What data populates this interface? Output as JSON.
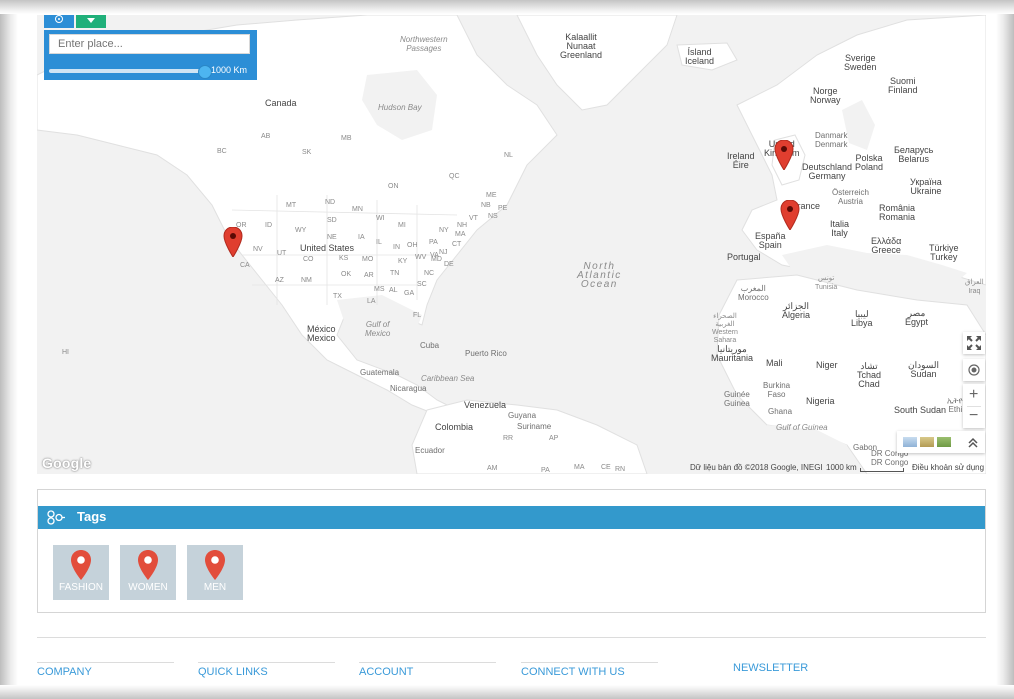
{
  "map": {
    "search": {
      "placeholder": "Enter place...",
      "radius_label": "1000 Km",
      "radius_fraction": 1.0
    },
    "labels": {
      "northwestern_passages": "Northwestern\nPassages",
      "kalaallit": "Kalaallit\nNunaat\nGreenland",
      "island": "Ísland\nIceland",
      "sverige": "Sverige\nSweden",
      "suomi": "Suomi\nFinland",
      "norge": "Norge\nNorway",
      "canada": "Canada",
      "hudson_bay": "Hudson Bay",
      "ab": "AB",
      "mb": "MB",
      "bc": "BC",
      "sk": "SK",
      "nl": "NL",
      "qc": "QC",
      "on": "ON",
      "pe": "PE",
      "nb": "NB",
      "ns": "NS",
      "mt": "MT",
      "nd": "ND",
      "mn": "MN",
      "sd": "SD",
      "wi": "WI",
      "mi": "MI",
      "or": "OR",
      "id": "ID",
      "wy": "WY",
      "ne": "NE",
      "ia": "IA",
      "il": "IL",
      "in": "IN",
      "oh": "OH",
      "pa": "PA",
      "ny": "NY",
      "vt": "VT",
      "nh": "NH",
      "me": "ME",
      "ma": "MA",
      "ct": "CT",
      "ri": "RI",
      "nj": "NJ",
      "md": "MD",
      "de": "DE",
      "nv": "NV",
      "ut": "UT",
      "co": "CO",
      "ks": "KS",
      "mo": "MO",
      "ky": "KY",
      "wv": "WV",
      "va": "VA",
      "ca": "CA",
      "az": "AZ",
      "nm": "NM",
      "ok": "OK",
      "ar": "AR",
      "tn": "TN",
      "nc": "NC",
      "sc": "SC",
      "ms": "MS",
      "al": "AL",
      "ga": "GA",
      "tx": "TX",
      "la": "LA",
      "fl": "FL",
      "hi": "HI",
      "united_states": "United States",
      "mexico": "México\nMexico",
      "gulf_of_mexico": "Gulf of\nMexico",
      "cuba": "Cuba",
      "puerto_rico": "Puerto Rico",
      "guatemala": "Guatemala",
      "nicaragua": "Nicaragua",
      "caribbean": "Caribbean Sea",
      "venezuela": "Venezuela",
      "guyana": "Guyana",
      "suriname": "Suriname",
      "colombia": "Colombia",
      "rr": "RR",
      "ap": "AP",
      "ecuador": "Ecuador",
      "am": "AM",
      "pa2": "PA",
      "ma2": "MA",
      "ce": "CE",
      "rn": "RN",
      "north_atlantic": "North\nAtlantic\nOcean",
      "ireland": "Ireland\nÉire",
      "united_kingdom": "United\nKingdom",
      "danmark": "Danmark\nDenmark",
      "deutschland": "Deutschland\nGermany",
      "polska": "Polska\nPoland",
      "belarus": "Беларусь\nBelarus",
      "ukraine": "Україна\nUkraine",
      "osterreich": "Österreich\nAustria",
      "france": "France",
      "romania": "România\nRomania",
      "italia": "Italia\nItaly",
      "espana": "España\nSpain",
      "portugal": "Portugal",
      "greece": "Ελλάδα\nGreece",
      "turkiye": "Türkiye\nTurkey",
      "tunisia": "تونس\nTunisia",
      "iraq": "العراق\nIraq",
      "morocco": "المغرب\nMorocco",
      "algeria": "الجزائر\nAlgeria",
      "libya": "ليبيا\nLibya",
      "egypt": "مصر\nEgypt",
      "western_sahara": "الصحراء\nالغربية\nWestern\nSahara",
      "mauritania": "موريتانيا\nMauritania",
      "mali": "Mali",
      "niger": "Niger",
      "chad": "تشاد\nTchad\nChad",
      "sudan": "السودان\nSudan",
      "burkina": "Burkina\nFaso",
      "guinea": "Guinée\nGuinea",
      "nigeria": "Nigeria",
      "ghana": "Ghana",
      "south_sudan": "South Sudan",
      "ethiopia": "ኢትዮ\nEthi",
      "gulf_of_guinea": "Gulf of Guinea",
      "gabon": "Gabon",
      "dr_congo": "DR Congo\nDR Congo"
    },
    "attribution": "Dữ liệu bản đồ ©2018 Google, INEGI",
    "scale": "1000 km",
    "terms": "Điều khoản sử dụng",
    "google_logo": "Google",
    "controls": {
      "fullscreen_icon": "fullscreen-icon",
      "locate_icon": "locate-icon",
      "zoom_in": "+",
      "zoom_out": "−",
      "collapse_icon": "chevron-up-icon"
    },
    "colors": {
      "water": "#f2f2f2",
      "land": "#ffffff",
      "marker": "#e03e2f",
      "panel_blue": "#2c8ed6"
    }
  },
  "tags": {
    "title": "Tags",
    "items": [
      {
        "label": "FASHION"
      },
      {
        "label": "WOMEN"
      },
      {
        "label": "MEN"
      }
    ]
  },
  "footer": {
    "company": "COMPANY",
    "quick_links": "QUICK LINKS",
    "account": "ACCOUNT",
    "connect": "CONNECT WITH US",
    "newsletter": "NEWSLETTER"
  }
}
